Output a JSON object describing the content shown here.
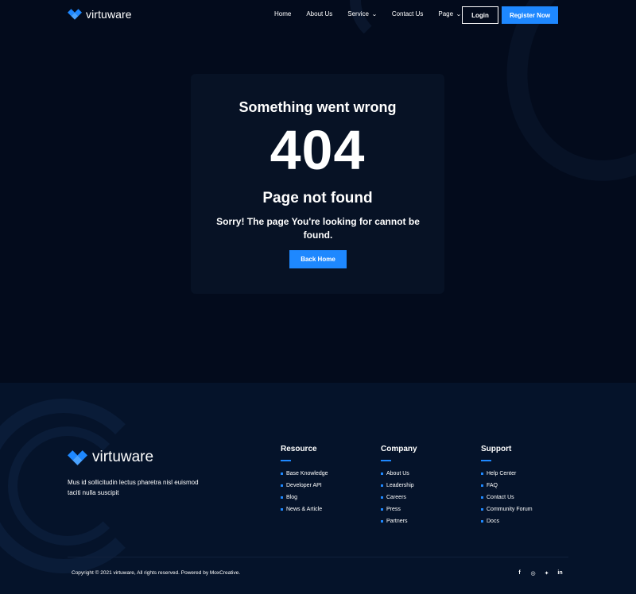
{
  "header": {
    "brand": "virtuware",
    "nav": [
      {
        "label": "Home"
      },
      {
        "label": "About Us"
      },
      {
        "label": "Service",
        "dropdown": true
      },
      {
        "label": "Contact Us"
      },
      {
        "label": "Page",
        "dropdown": true
      }
    ],
    "login_label": "Login",
    "register_label": "Register Now"
  },
  "error": {
    "title": "Something went wrong",
    "code": "404",
    "subtitle": "Page not found",
    "message": "Sorry! The page You're looking for cannot be found.",
    "button_label": "Back Home"
  },
  "footer": {
    "brand": "virtuware",
    "description": "Mus id sollicitudin lectus pharetra nisl euismod taciti nulla suscipit",
    "columns": [
      {
        "title": "Resource",
        "links": [
          "Base Knowledge",
          "Developer API",
          "Blog",
          "News & Article"
        ]
      },
      {
        "title": "Company",
        "links": [
          "About Us",
          "Leadership",
          "Careers",
          "Press",
          "Partners"
        ]
      },
      {
        "title": "Support",
        "links": [
          "Help Center",
          "FAQ",
          "Contact Us",
          "Community Forum",
          "Docs"
        ]
      }
    ],
    "copyright": "Copyright © 2021 virtuware, All rights reserved. Powered by MoxCreative.",
    "socials": [
      {
        "name": "facebook-icon",
        "glyph": "f"
      },
      {
        "name": "instagram-icon",
        "glyph": "◎"
      },
      {
        "name": "twitter-icon",
        "glyph": "✦"
      },
      {
        "name": "linkedin-icon",
        "glyph": "in"
      }
    ]
  },
  "colors": {
    "background": "#030b1c",
    "card": "#071225",
    "footer": "#05132a",
    "accent": "#1e88ff"
  }
}
